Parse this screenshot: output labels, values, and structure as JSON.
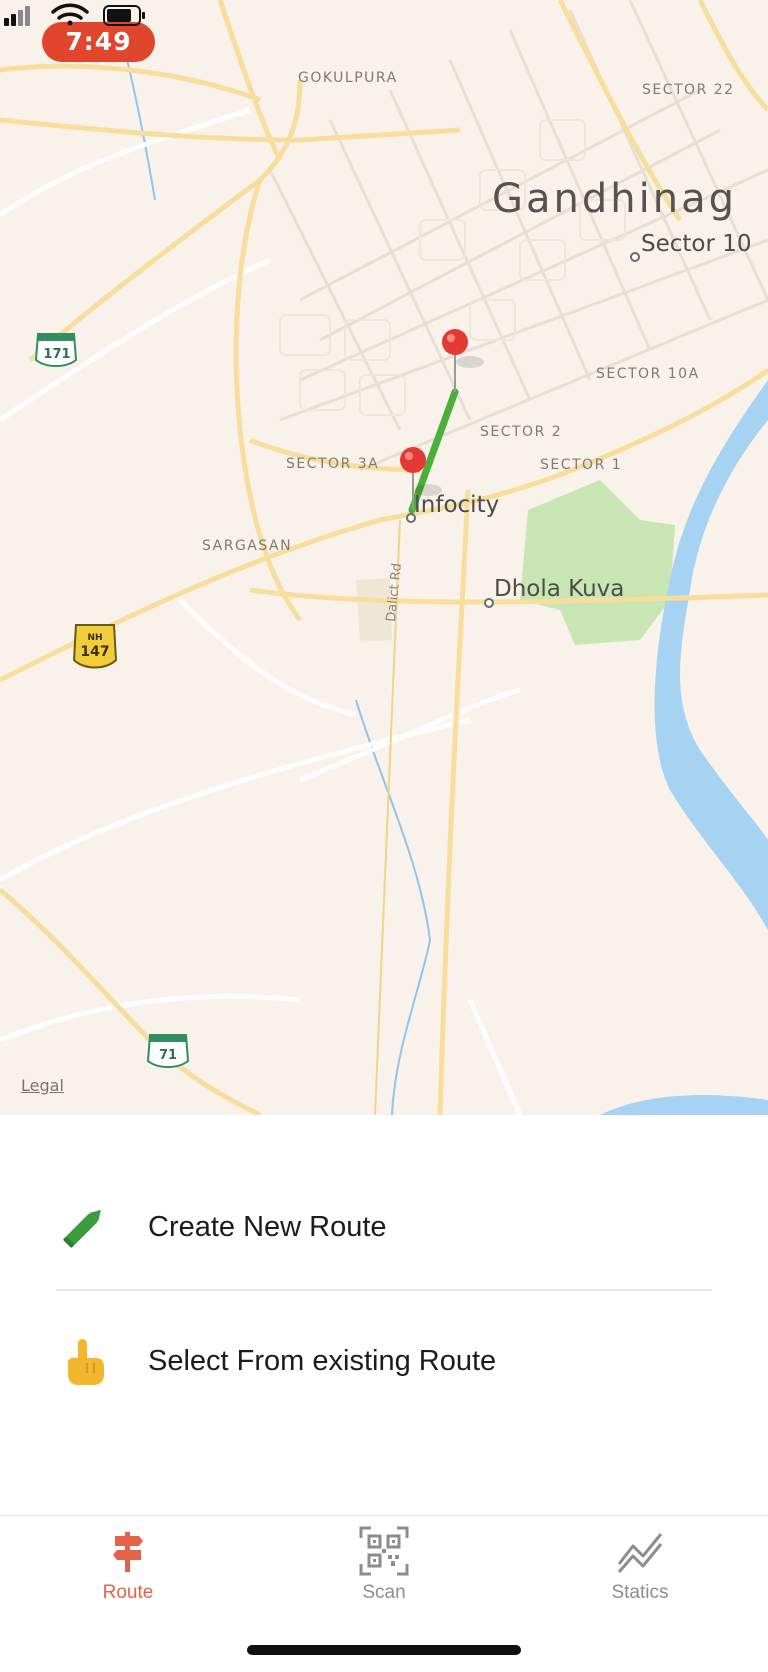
{
  "status_bar": {
    "time": "7:49"
  },
  "map": {
    "labels": {
      "gokulpura": "GOKULPURA",
      "sector22": "SECTOR 22",
      "city": "Gandhinag",
      "sector10": "Sector 10",
      "sector10a": "SECTOR 10A",
      "sector2": "SECTOR 2",
      "sector3a": "SECTOR 3A",
      "sector1": "SECTOR 1",
      "infocity": "Infocity",
      "sargasan": "SARGASAN",
      "dholakuva": "Dhola Kuva",
      "road": "Dalict Rd"
    },
    "shields": {
      "s171": "171",
      "nh_prefix": "NH",
      "nh147": "147",
      "s71": "71"
    },
    "legal": "Legal",
    "route_color": "#4caf3a",
    "pin_color": "#e53935"
  },
  "options": [
    {
      "label": "Create New Route",
      "icon": "pencil-icon",
      "color": "#3c9b3a"
    },
    {
      "label": "Select From existing Route",
      "icon": "pointing-hand-icon",
      "color": "#f2b72f"
    }
  ],
  "tabs": [
    {
      "label": "Route",
      "icon": "signpost-icon",
      "active": true
    },
    {
      "label": "Scan",
      "icon": "qr-code-icon",
      "active": false
    },
    {
      "label": "Statics",
      "icon": "trend-chart-icon",
      "active": false
    }
  ],
  "colors": {
    "accent": "#e4634a",
    "inactive": "#8d8d8d"
  }
}
